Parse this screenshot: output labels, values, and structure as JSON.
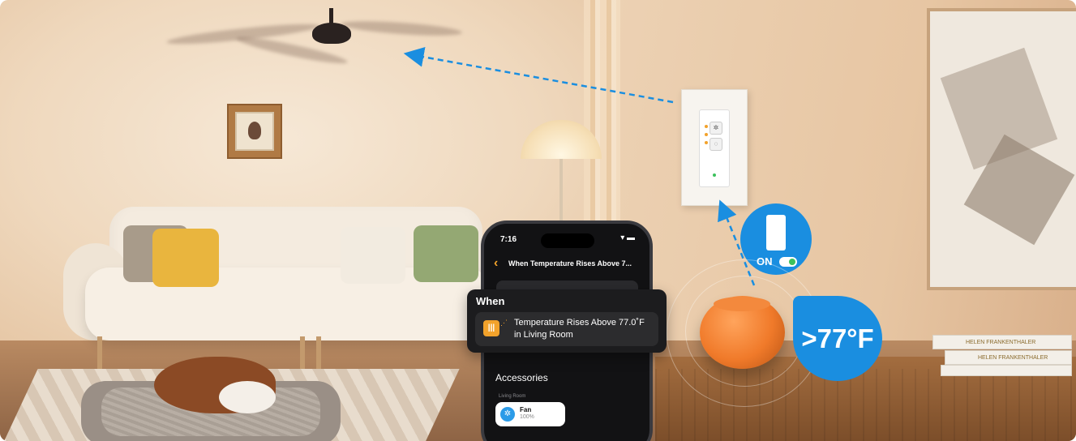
{
  "phone": {
    "time": "7:16",
    "status_icons": "▾ ▬",
    "back_glyph": "‹",
    "title": "When Temperature Rises Above 7...",
    "accessories_heading": "Accessories",
    "room": "Living Room",
    "fan_tile": {
      "name": "Fan",
      "level": "100%",
      "icon": "fan-icon"
    }
  },
  "when_card": {
    "title": "When",
    "line1": "Temperature Rises Above 77.0˚F",
    "line2": "in Living Room",
    "icon": "thermometer-icon"
  },
  "switch_badge": {
    "label": "ON"
  },
  "temperature_badge": {
    "text": ">77°F"
  },
  "books": {
    "spine1": "HELEN FRANKENTHALER",
    "spine2": "HELEN FRANKENTHALER"
  },
  "colors": {
    "accent_blue": "#1a8ee0",
    "accent_orange": "#f2a22b",
    "homepod_orange": "#f07a2a"
  }
}
